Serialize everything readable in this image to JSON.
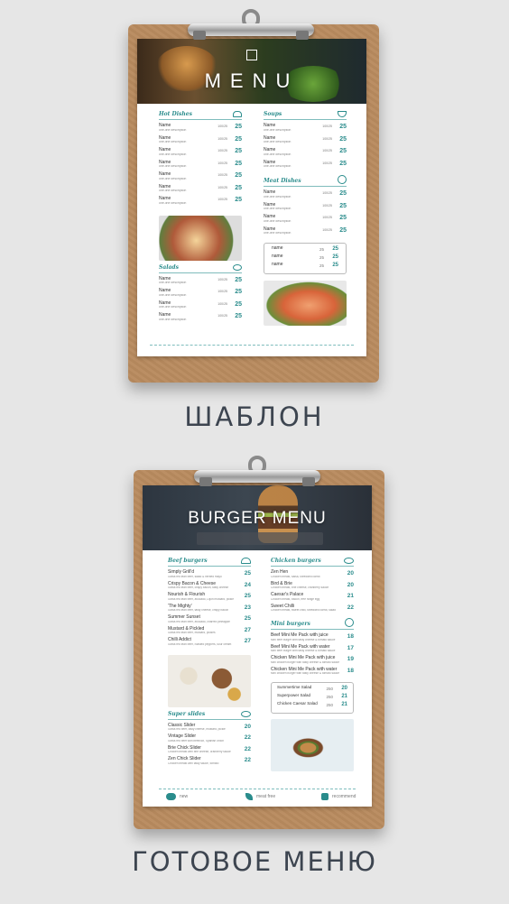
{
  "template": {
    "header_title": "MENU",
    "sections": {
      "hot": {
        "title": "Hot Dishes",
        "items": [
          {
            "name": "Name",
            "desc": "one-line description",
            "weight": "100/25",
            "price": "25"
          },
          {
            "name": "Name",
            "desc": "one-line description",
            "weight": "100/25",
            "price": "25"
          },
          {
            "name": "Name",
            "desc": "one-line description",
            "weight": "100/25",
            "price": "25"
          },
          {
            "name": "Name",
            "desc": "one-line description",
            "weight": "100/25",
            "price": "25"
          },
          {
            "name": "Name",
            "desc": "one-line description",
            "weight": "100/25",
            "price": "25"
          },
          {
            "name": "Name",
            "desc": "one-line description",
            "weight": "100/25",
            "price": "25"
          },
          {
            "name": "Name",
            "desc": "one-line description",
            "weight": "100/25",
            "price": "25"
          }
        ]
      },
      "salads": {
        "title": "Salads",
        "items": [
          {
            "name": "Name",
            "desc": "one-line description",
            "weight": "100/25",
            "price": "25"
          },
          {
            "name": "Name",
            "desc": "one-line description",
            "weight": "100/25",
            "price": "25"
          },
          {
            "name": "Name",
            "desc": "one-line description",
            "weight": "100/25",
            "price": "25"
          },
          {
            "name": "Name",
            "desc": "one-line description",
            "weight": "100/25",
            "price": "25"
          }
        ]
      },
      "soups": {
        "title": "Soups",
        "items": [
          {
            "name": "Name",
            "desc": "one-line description",
            "weight": "100/25",
            "price": "25"
          },
          {
            "name": "Name",
            "desc": "one-line description",
            "weight": "100/25",
            "price": "25"
          },
          {
            "name": "Name",
            "desc": "one-line description",
            "weight": "100/25",
            "price": "25"
          },
          {
            "name": "Name",
            "desc": "one-line description",
            "weight": "100/25",
            "price": "25"
          }
        ]
      },
      "meat": {
        "title": "Meat Dishes",
        "items": [
          {
            "name": "Name",
            "desc": "one-line description",
            "weight": "100/25",
            "price": "25"
          },
          {
            "name": "Name",
            "desc": "one-line description",
            "weight": "100/25",
            "price": "25"
          },
          {
            "name": "Name",
            "desc": "one-line description",
            "weight": "100/25",
            "price": "25"
          },
          {
            "name": "Name",
            "desc": "one-line description",
            "weight": "100/25",
            "price": "25"
          }
        ]
      },
      "box": [
        {
          "name": "name",
          "weight": "25",
          "price": "25"
        },
        {
          "name": "name",
          "weight": "25",
          "price": "25"
        },
        {
          "name": "name",
          "weight": "25",
          "price": "25"
        }
      ]
    }
  },
  "caption_top": "ШАБЛОН",
  "final": {
    "header_title": "BURGER MENU",
    "beef": {
      "title": "Beef burgers",
      "items": [
        {
          "name": "Simply Grill'd",
          "desc": "Grass fed lean beef, salad & herbed mayo",
          "price": "25"
        },
        {
          "name": "Crispy Bacon & Cheese",
          "desc": "Grass fed lean beef, crispy bacon, tasty cheese",
          "price": "24"
        },
        {
          "name": "Nourish & Flourish",
          "desc": "Grass fed lean beef, avocado, Dijon mustard, pickle",
          "price": "25"
        },
        {
          "name": "'The Mighty'",
          "desc": "Grass fed lean beef, tasty cheese, crispy bacon",
          "price": "23"
        },
        {
          "name": "Summer Sunset",
          "desc": "Grass fed lean beef, avocado, charred pineapple",
          "price": "25"
        },
        {
          "name": "Mustard & Pickled",
          "desc": "Grass fed lean beef, mustard, pickles",
          "price": "27"
        },
        {
          "name": "Chilli Addict",
          "desc": "Grass fed lean beef, roasted peppers, sour cream",
          "price": "27"
        }
      ]
    },
    "super": {
      "title": "Super slides",
      "items": [
        {
          "name": "Classic Slider",
          "desc": "Grass fed beef, tasty cheese, mustard, pickle",
          "price": "20"
        },
        {
          "name": "Vintage Slider",
          "desc": "Grass fed beef with beetroot, Spanish onion",
          "price": "22"
        },
        {
          "name": "Brie Chick Slider",
          "desc": "Chicken breast with brie cheese, cranberry sauce",
          "price": "22"
        },
        {
          "name": "Zen Chick Slider",
          "desc": "Chicken breast with tasty sauce, tomato",
          "price": "22"
        }
      ]
    },
    "chicken": {
      "title": "Chicken burgers",
      "items": [
        {
          "name": "Zen Hen",
          "desc": "Chicken breast, salsa, shredded carrot",
          "price": "20"
        },
        {
          "name": "Bird & Brie",
          "desc": "Chicken breast, brie cheese, cranberry sauce",
          "price": "20"
        },
        {
          "name": "Caesar's Palace",
          "desc": "Chicken breast, bacon, free range egg",
          "price": "21"
        },
        {
          "name": "Sweet Chilli",
          "desc": "Chicken breast, sweet chilli, shredded carrot, salad",
          "price": "22"
        }
      ]
    },
    "mini": {
      "title": "Mini burgers",
      "items": [
        {
          "name": "Beef Mini Me Pack with juice",
          "desc": "Mini beef burger with tasty cheese & tomato sauce",
          "price": "18"
        },
        {
          "name": "Beef Mini Me Pack with water",
          "desc": "Mini beef burger with tasty cheese & tomato sauce",
          "price": "17"
        },
        {
          "name": "Chicken Mini Me Pack with juice",
          "desc": "Mini chicken burger with tasty cheese & tomato sauce",
          "price": "19"
        },
        {
          "name": "Chicken Mini Me Pack with water",
          "desc": "Mini chicken burger with tasty cheese & tomato sauce",
          "price": "18"
        }
      ]
    },
    "salads": [
      {
        "name": "Summertime Salad",
        "weight": "250",
        "price": "20"
      },
      {
        "name": "Superpower Salad",
        "weight": "250",
        "price": "21"
      },
      {
        "name": "Chicken Caesar Salad",
        "weight": "250",
        "price": "21"
      }
    ],
    "footer": {
      "new": "new",
      "meat_free": "meat free",
      "recommend": "recommend"
    }
  },
  "caption_bottom": "ГОТОВОЕ МЕНЮ",
  "colors": {
    "accent": "#2a8c8c",
    "board": "#b98b5f",
    "background": "#e6e6e6"
  }
}
